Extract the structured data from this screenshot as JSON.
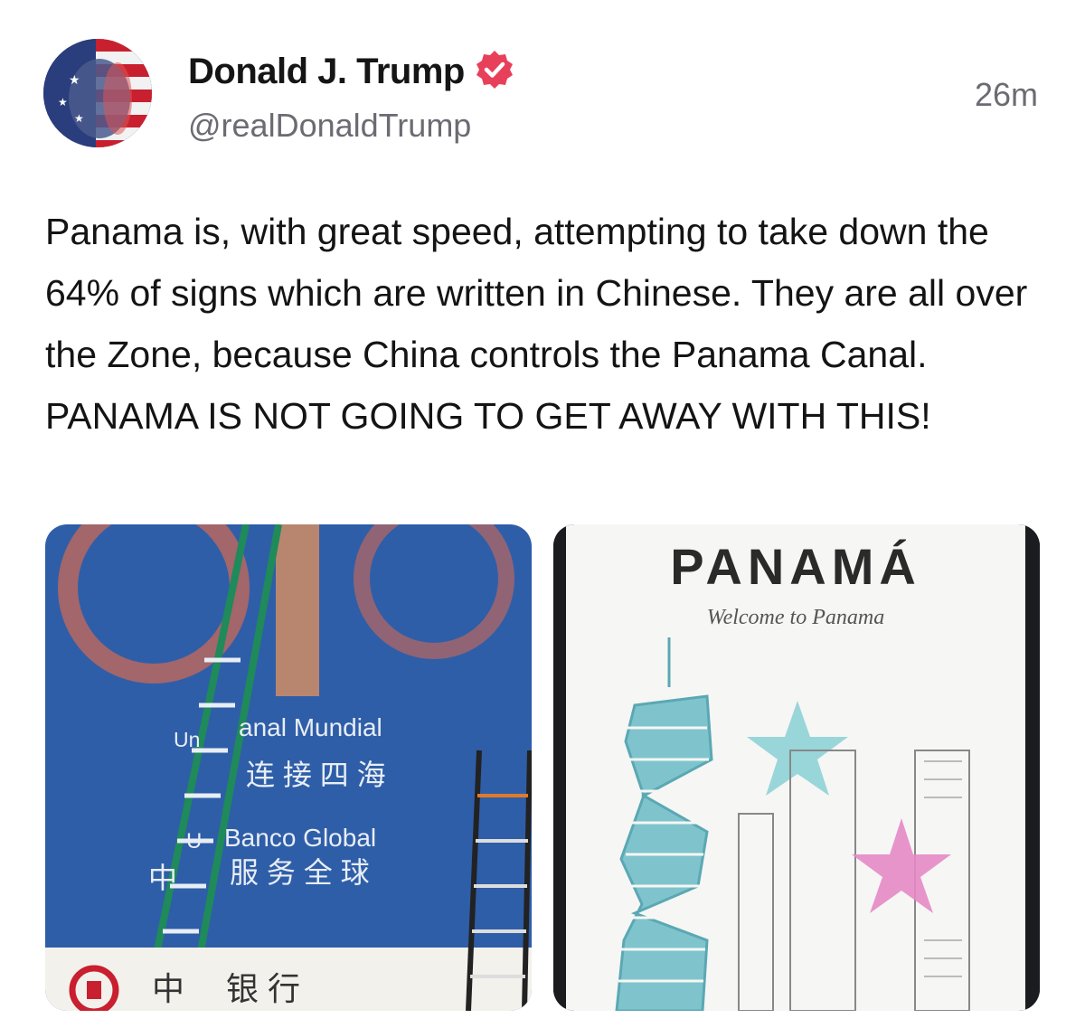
{
  "post": {
    "author": {
      "display_name": "Donald J. Trump",
      "handle": "@realDonaldTrump",
      "verified": true,
      "verified_icon": "verified-badge-icon",
      "avatar": "profile-avatar"
    },
    "timestamp": "26m",
    "text": "Panama is, with great speed, attempting to take down the 64% of signs which are written in Chinese. They are all over the Zone, because China controls the Panama Canal. PANAMA IS NOT GOING TO GET AWAY WITH THIS!"
  },
  "media": [
    {
      "kind": "photo",
      "sign_lines": [
        "Un",
        "anal Mundial",
        "连 接 四 海",
        "U",
        "Banco Global",
        "中",
        "服 务 全 球",
        "中",
        "银 行"
      ]
    },
    {
      "kind": "photo",
      "sign_title": "PANAMÁ",
      "sign_subtitle": "Welcome to Panama"
    }
  ],
  "colors": {
    "accent_verified": "#e8405a",
    "handle_gray": "#6b6b73",
    "sign_blue": "#2f5ea8",
    "tower_teal": "#7fc4cc",
    "star_pink": "#e58ac7"
  }
}
